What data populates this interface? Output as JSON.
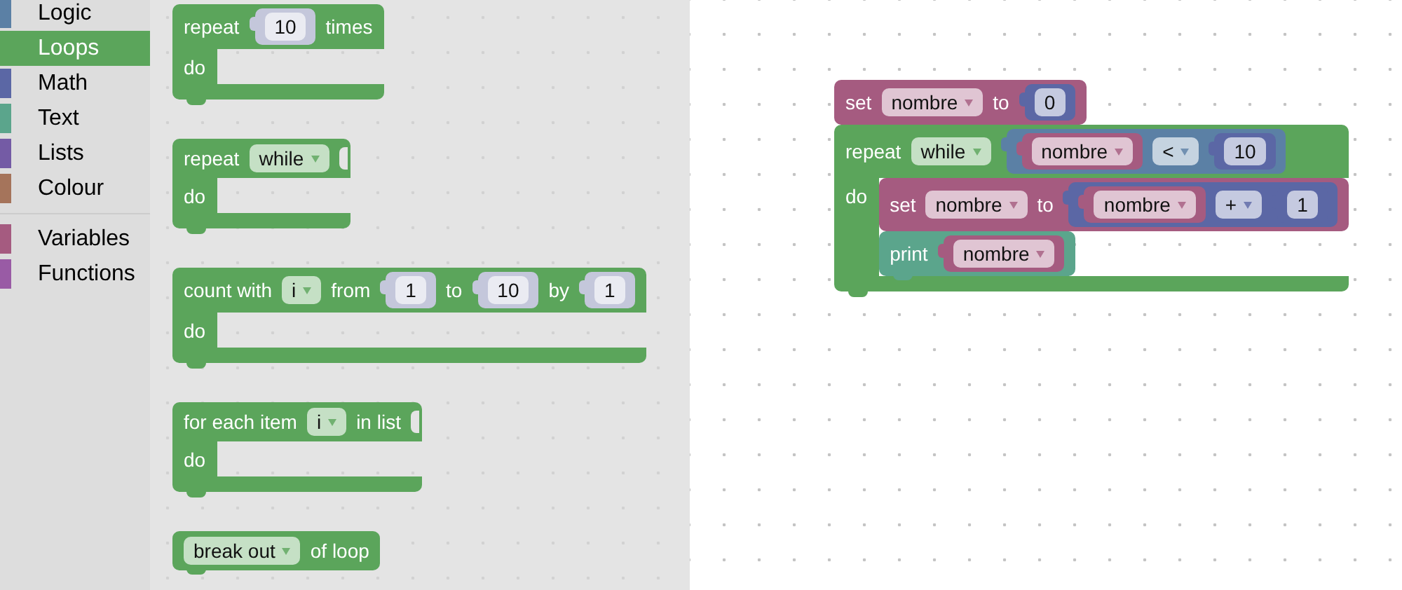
{
  "toolbox": {
    "groups": [
      {
        "items": [
          {
            "label": "Logic",
            "color": "#5b80a5",
            "selected": false
          },
          {
            "label": "Loops",
            "color": "#5ba55b",
            "selected": true
          },
          {
            "label": "Math",
            "color": "#5b67a5",
            "selected": false
          },
          {
            "label": "Text",
            "color": "#5ba58c",
            "selected": false
          },
          {
            "label": "Lists",
            "color": "#745ba5",
            "selected": false
          },
          {
            "label": "Colour",
            "color": "#a5745b",
            "selected": false
          }
        ]
      },
      {
        "items": [
          {
            "label": "Variables",
            "color": "#a55b80",
            "selected": false
          },
          {
            "label": "Functions",
            "color": "#995ba5",
            "selected": false
          }
        ]
      }
    ]
  },
  "flyout": {
    "blocks": [
      {
        "kind": "statement",
        "color": "#5ba55b",
        "rows": [
          {
            "kind": "line",
            "items": [
              {
                "kind": "label",
                "text": "repeat"
              },
              {
                "kind": "input",
                "block": {
                  "kind": "value",
                  "color": "#c4c7db",
                  "rows": [
                    {
                      "kind": "line",
                      "items": [
                        {
                          "kind": "number",
                          "text": "10"
                        }
                      ]
                    }
                  ]
                }
              },
              {
                "kind": "label",
                "text": "times"
              }
            ]
          },
          {
            "kind": "statement",
            "items": [
              {
                "kind": "label",
                "text": "do"
              }
            ]
          }
        ]
      },
      {
        "kind": "statement",
        "color": "#5ba55b",
        "rows": [
          {
            "kind": "line",
            "items": [
              {
                "kind": "label",
                "text": "repeat"
              },
              {
                "kind": "dropdown",
                "text": "while"
              },
              {
                "kind": "input"
              }
            ]
          },
          {
            "kind": "statement",
            "items": [
              {
                "kind": "label",
                "text": "do"
              }
            ]
          }
        ]
      },
      {
        "kind": "statement",
        "color": "#5ba55b",
        "rows": [
          {
            "kind": "line",
            "items": [
              {
                "kind": "label",
                "text": "count with"
              },
              {
                "kind": "dropdown",
                "text": "i"
              },
              {
                "kind": "label",
                "text": "from"
              },
              {
                "kind": "input",
                "block": {
                  "kind": "value",
                  "color": "#c4c7db",
                  "rows": [
                    {
                      "kind": "line",
                      "items": [
                        {
                          "kind": "number",
                          "text": "1"
                        }
                      ]
                    }
                  ]
                }
              },
              {
                "kind": "label",
                "text": "to"
              },
              {
                "kind": "input",
                "block": {
                  "kind": "value",
                  "color": "#c4c7db",
                  "rows": [
                    {
                      "kind": "line",
                      "items": [
                        {
                          "kind": "number",
                          "text": "10"
                        }
                      ]
                    }
                  ]
                }
              },
              {
                "kind": "label",
                "text": "by"
              },
              {
                "kind": "input",
                "block": {
                  "kind": "value",
                  "color": "#c4c7db",
                  "rows": [
                    {
                      "kind": "line",
                      "items": [
                        {
                          "kind": "number",
                          "text": "1"
                        }
                      ]
                    }
                  ]
                }
              }
            ]
          },
          {
            "kind": "statement",
            "items": [
              {
                "kind": "label",
                "text": "do"
              }
            ]
          }
        ]
      },
      {
        "kind": "statement",
        "color": "#5ba55b",
        "rows": [
          {
            "kind": "line",
            "items": [
              {
                "kind": "label",
                "text": "for each item"
              },
              {
                "kind": "dropdown",
                "text": "i"
              },
              {
                "kind": "label",
                "text": "in list"
              },
              {
                "kind": "input"
              }
            ]
          },
          {
            "kind": "statement",
            "items": [
              {
                "kind": "label",
                "text": "do"
              }
            ]
          }
        ]
      },
      {
        "kind": "statement",
        "color": "#5ba55b",
        "rows": [
          {
            "kind": "line",
            "items": [
              {
                "kind": "dropdown",
                "text": "break out"
              },
              {
                "kind": "label",
                "text": "of loop"
              }
            ]
          }
        ]
      }
    ]
  },
  "workspace": {
    "blocks": [
      {
        "kind": "statement",
        "color": "#a55b80",
        "rows": [
          {
            "kind": "line",
            "items": [
              {
                "kind": "label",
                "text": "set"
              },
              {
                "kind": "dropdown",
                "text": "nombre"
              },
              {
                "kind": "label",
                "text": "to"
              },
              {
                "kind": "input",
                "block": {
                  "kind": "value",
                  "color": "#5b67a5",
                  "rows": [
                    {
                      "kind": "line",
                      "items": [
                        {
                          "kind": "number",
                          "text": "0"
                        }
                      ]
                    }
                  ]
                }
              }
            ]
          }
        ]
      },
      {
        "kind": "statement",
        "color": "#5ba55b",
        "rows": [
          {
            "kind": "line",
            "items": [
              {
                "kind": "label",
                "text": "repeat"
              },
              {
                "kind": "dropdown",
                "text": "while"
              },
              {
                "kind": "input",
                "block": {
                  "kind": "value",
                  "color": "#5b80a5",
                  "rows": [
                    {
                      "kind": "line",
                      "items": [
                        {
                          "kind": "input",
                          "block": {
                            "kind": "value",
                            "color": "#a55b80",
                            "rows": [
                              {
                                "kind": "line",
                                "items": [
                                  {
                                    "kind": "dropdown",
                                    "text": "nombre"
                                  }
                                ]
                              }
                            ]
                          }
                        },
                        {
                          "kind": "dropdown",
                          "text": "<"
                        },
                        {
                          "kind": "input",
                          "block": {
                            "kind": "value",
                            "color": "#5b67a5",
                            "rows": [
                              {
                                "kind": "line",
                                "items": [
                                  {
                                    "kind": "number",
                                    "text": "10"
                                  }
                                ]
                              }
                            ]
                          }
                        }
                      ]
                    }
                  ]
                }
              }
            ]
          },
          {
            "kind": "statement",
            "items": [
              {
                "kind": "label",
                "text": "do"
              }
            ],
            "blocks": [
              {
                "kind": "statement",
                "color": "#a55b80",
                "rows": [
                  {
                    "kind": "line",
                    "items": [
                      {
                        "kind": "label",
                        "text": "set"
                      },
                      {
                        "kind": "dropdown",
                        "text": "nombre"
                      },
                      {
                        "kind": "label",
                        "text": "to"
                      },
                      {
                        "kind": "input",
                        "block": {
                          "kind": "value",
                          "color": "#5b67a5",
                          "rows": [
                            {
                              "kind": "line",
                              "items": [
                                {
                                  "kind": "input",
                                  "block": {
                                    "kind": "value",
                                    "color": "#a55b80",
                                    "rows": [
                                      {
                                        "kind": "line",
                                        "items": [
                                          {
                                            "kind": "dropdown",
                                            "text": "nombre"
                                          }
                                        ]
                                      }
                                    ]
                                  }
                                },
                                {
                                  "kind": "dropdown",
                                  "text": "+"
                                },
                                {
                                  "kind": "input",
                                  "block": {
                                    "kind": "value",
                                    "color": "#5b67a5",
                                    "rows": [
                                      {
                                        "kind": "line",
                                        "items": [
                                          {
                                            "kind": "number",
                                            "text": "1"
                                          }
                                        ]
                                      }
                                    ]
                                  }
                                }
                              ]
                            }
                          ]
                        }
                      }
                    ]
                  }
                ]
              },
              {
                "kind": "statement",
                "color": "#5ba58c",
                "rows": [
                  {
                    "kind": "line",
                    "items": [
                      {
                        "kind": "label",
                        "text": "print"
                      },
                      {
                        "kind": "input",
                        "block": {
                          "kind": "value",
                          "color": "#a55b80",
                          "rows": [
                            {
                              "kind": "line",
                              "items": [
                                {
                                  "kind": "dropdown",
                                  "text": "nombre"
                                }
                              ]
                            }
                          ]
                        }
                      }
                    ]
                  }
                ]
              }
            ]
          }
        ]
      }
    ]
  }
}
